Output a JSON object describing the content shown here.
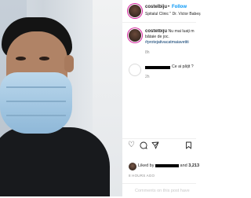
{
  "post": {
    "username": "costelbiju",
    "follow_label": "Follow",
    "separator": "•",
    "location": "Spitalul Clinic \" Dr. Victor Babeș",
    "caption_user": "costelbiju",
    "caption_line1": " Nu mai luați m",
    "caption_line2": "bătaie de joc.",
    "caption_hashtag": "#protejativacatmaiavetiti",
    "caption_time": "8h"
  },
  "comments": [
    {
      "text": "Ce ai pățit ?",
      "time": "2h"
    }
  ],
  "actions": {
    "heart_icon": "heart-outline-icon",
    "comment_icon": "comment-bubble-icon",
    "share_icon": "paper-plane-icon",
    "bookmark_icon": "bookmark-icon"
  },
  "likes": {
    "prefix": "Liked by ",
    "middle": " and ",
    "count": "3,213"
  },
  "posted_time": "8 HOURS AGO",
  "add_comment_placeholder": "Comments on this post have",
  "colors": {
    "follow": "#0095f6",
    "hashtag": "#00376b",
    "text": "#262626",
    "muted": "#8e8e8e",
    "mask": "#9fc4e0"
  }
}
